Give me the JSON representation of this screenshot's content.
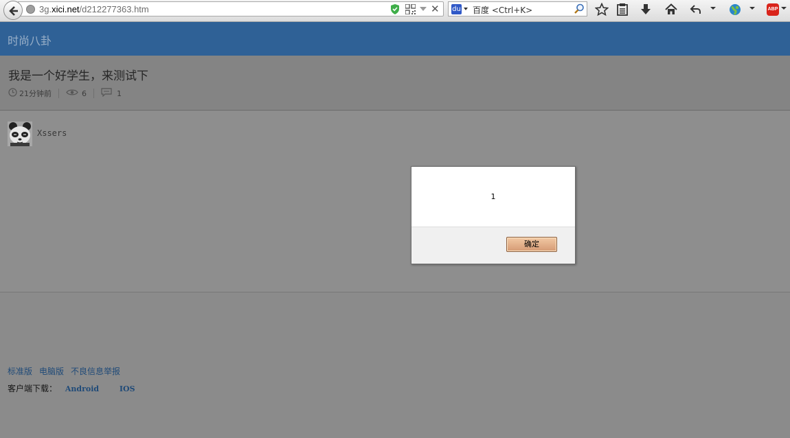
{
  "browser": {
    "url_prefix": "3g.",
    "url_host": "xici.net",
    "url_path": "/d212277363.htm",
    "search_placeholder": "百度 <Ctrl+K>",
    "abp_label": "ABP",
    "baidu_glyph": "du"
  },
  "site": {
    "header_title": "时尚八卦"
  },
  "post": {
    "title": "我是一个好学生，来测试下",
    "time": "21分钟前",
    "views": "6",
    "comments": "1",
    "author": "Xssers"
  },
  "footer": {
    "links": [
      "标准版",
      "电脑版",
      "不良信息举报"
    ],
    "download_label": "客户端下载：",
    "android": "Android",
    "ios": "IOS"
  },
  "dialog": {
    "message": "1",
    "ok_label": "确定"
  },
  "colors": {
    "header_bg": "#2f6196",
    "link": "#1f4a78",
    "overlay": "#8b8b8b"
  }
}
